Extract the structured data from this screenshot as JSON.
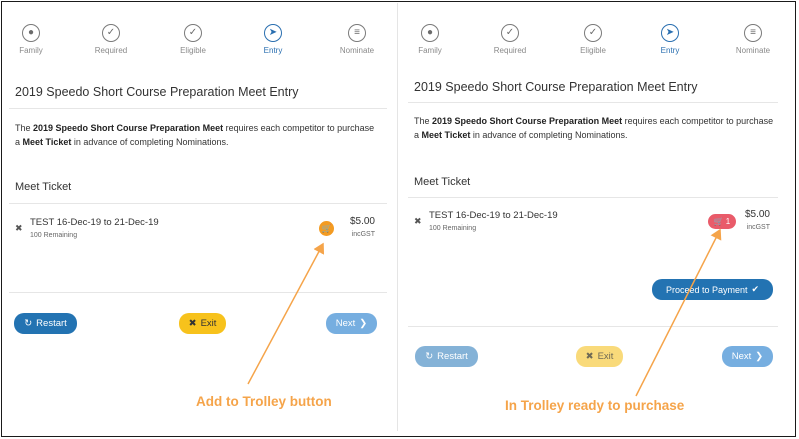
{
  "steps": [
    {
      "label": "Family",
      "icon": "users-icon"
    },
    {
      "label": "Required",
      "icon": "check-icon"
    },
    {
      "label": "Eligible",
      "icon": "check-icon"
    },
    {
      "label": "Entry",
      "icon": "compass-icon"
    },
    {
      "label": "Nominate",
      "icon": "list-icon"
    }
  ],
  "page_title": "2019 Speedo Short Course Preparation Meet Entry",
  "description": {
    "part1": "The ",
    "meet_name": "2019 Speedo Short Course Preparation Meet",
    "part2": " requires each competitor to purchase a ",
    "ticket_term": "Meet Ticket",
    "part3": " in advance of completing Nominations."
  },
  "section_title": "Meet Ticket",
  "ticket": {
    "remove_symbol": "✖",
    "name": "TEST 16-Dec-19 to 21-Dec-19",
    "remaining": "100 Remaining",
    "price": "$5.00",
    "tax_note": "incGST",
    "trolley_count": "1"
  },
  "buttons": {
    "restart": "Restart",
    "exit": "Exit",
    "next": "Next",
    "proceed": "Proceed to Payment"
  },
  "annotations": {
    "left": "Add to Trolley button",
    "right": "In Trolley ready to purchase"
  },
  "colors": {
    "accent_blue": "#2373b2",
    "exit_yellow": "#f7c21c",
    "trolley_orange": "#f39b22",
    "trolley_red": "#e95b6a",
    "annotation_orange": "#f5a44a"
  }
}
